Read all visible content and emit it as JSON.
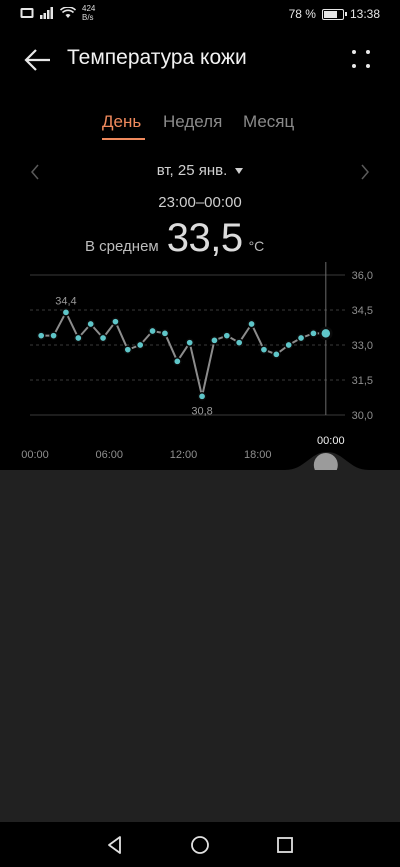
{
  "status_bar": {
    "net_speed_value": "424",
    "net_speed_unit": "B/s",
    "battery": "78 %",
    "battery_level": 0.78,
    "time": "13:38"
  },
  "header": {
    "title": "Температура кожи"
  },
  "tabs": [
    {
      "label": "День",
      "active": true
    },
    {
      "label": "Неделя",
      "active": false
    },
    {
      "label": "Месяц",
      "active": false
    }
  ],
  "date_selector": {
    "label": "вт, 25 янв."
  },
  "summary": {
    "time_range": "23:00–00:00",
    "avg_label": "В среднем",
    "avg_value": "33,5",
    "unit": "°C"
  },
  "chart_data": {
    "type": "line",
    "x_tick_labels": [
      "00:00",
      "06:00",
      "12:00",
      "18:00",
      "00:00"
    ],
    "x_ticks": [
      0,
      6,
      12,
      18,
      24
    ],
    "y_tick_labels": [
      "36,0",
      "34,5",
      "33,0",
      "31,5",
      "30,0"
    ],
    "y_ticks": [
      36.0,
      34.5,
      33.0,
      31.5,
      30.0
    ],
    "xlim": [
      0,
      24
    ],
    "ylim": [
      30.0,
      36.0
    ],
    "x": [
      0.5,
      1.5,
      2.5,
      3.5,
      4.5,
      5.5,
      6.5,
      7.5,
      8.5,
      9.5,
      10.5,
      11.5,
      12.5,
      13.5,
      14.5,
      15.5,
      16.5,
      17.5,
      18.5,
      19.5,
      20.5,
      21.5,
      22.5,
      23.5
    ],
    "y": [
      33.4,
      33.4,
      34.4,
      33.3,
      33.9,
      33.3,
      34.0,
      32.8,
      33.0,
      33.6,
      33.5,
      32.3,
      33.1,
      30.8,
      33.2,
      33.4,
      33.1,
      33.9,
      32.8,
      32.6,
      33.0,
      33.3,
      33.5,
      33.5
    ],
    "labels": [
      {
        "x": 2.5,
        "y": 34.4,
        "text": "34,4"
      },
      {
        "x": 13.5,
        "y": 30.8,
        "text": "30,8"
      }
    ],
    "selected": {
      "x": 23.5,
      "y": 33.5,
      "label": "00:00"
    },
    "grid": true,
    "colors": {
      "line": "#8c8c8c",
      "marker": "#5fc6c9",
      "grid": "#3a3a3a"
    }
  },
  "nav_bar": {
    "back": "triangle-back-icon",
    "home": "circle-home-icon",
    "recents": "square-recents-icon"
  }
}
